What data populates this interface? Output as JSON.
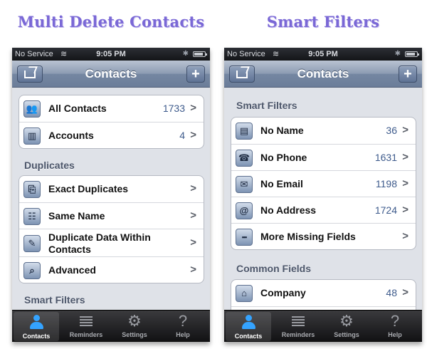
{
  "left": {
    "caption": "Multi Delete Contacts",
    "status": {
      "carrier": "No Service",
      "time": "9:05 PM"
    },
    "nav": {
      "title": "Contacts",
      "add": "+"
    },
    "group1": [
      {
        "icon": "contacts-icon",
        "glyph": "👥",
        "label": "All Contacts",
        "count": "1733"
      },
      {
        "icon": "accounts-icon",
        "glyph": "▥",
        "label": "Accounts",
        "count": "4"
      }
    ],
    "duplicates_header": "Duplicates",
    "group2": [
      {
        "icon": "exact-duplicates-icon",
        "glyph": "⎘",
        "label": "Exact Duplicates"
      },
      {
        "icon": "same-name-icon",
        "glyph": "☷",
        "label": "Same Name"
      },
      {
        "icon": "duplicate-data-icon",
        "glyph": "✎",
        "label": "Duplicate Data Within Contacts"
      },
      {
        "icon": "magnifier-icon",
        "glyph": "⌕",
        "label": "Advanced"
      }
    ],
    "smart_filters_header": "Smart Filters"
  },
  "right": {
    "caption": "Smart Filters",
    "status": {
      "carrier": "No Service",
      "time": "9:05 PM"
    },
    "nav": {
      "title": "Contacts",
      "add": "+"
    },
    "smart_filters_header": "Smart Filters",
    "group1": [
      {
        "icon": "id-card-icon",
        "glyph": "▤",
        "label": "No Name",
        "count": "36"
      },
      {
        "icon": "phone-icon",
        "glyph": "☎",
        "label": "No Phone",
        "count": "1631"
      },
      {
        "icon": "envelope-icon",
        "glyph": "✉",
        "label": "No Email",
        "count": "1198"
      },
      {
        "icon": "at-sign-icon",
        "glyph": "@",
        "label": "No Address",
        "count": "1724"
      },
      {
        "icon": "more-icon",
        "glyph": "•••",
        "label": "More Missing Fields"
      }
    ],
    "common_fields_header": "Common Fields",
    "group2": [
      {
        "icon": "company-icon",
        "glyph": "⌂",
        "label": "Company",
        "count": "48"
      }
    ]
  },
  "tabs": [
    {
      "label": "Contacts",
      "icon": "person-icon"
    },
    {
      "label": "Reminders",
      "icon": "list-icon"
    },
    {
      "label": "Settings",
      "icon": "gear-icon"
    },
    {
      "label": "Help",
      "icon": "question-icon"
    }
  ],
  "colors": {
    "caption": "#7a68d6",
    "navbar": "#7587a2",
    "count": "#3e5b8c",
    "active_tab": "#3aa4ff"
  }
}
